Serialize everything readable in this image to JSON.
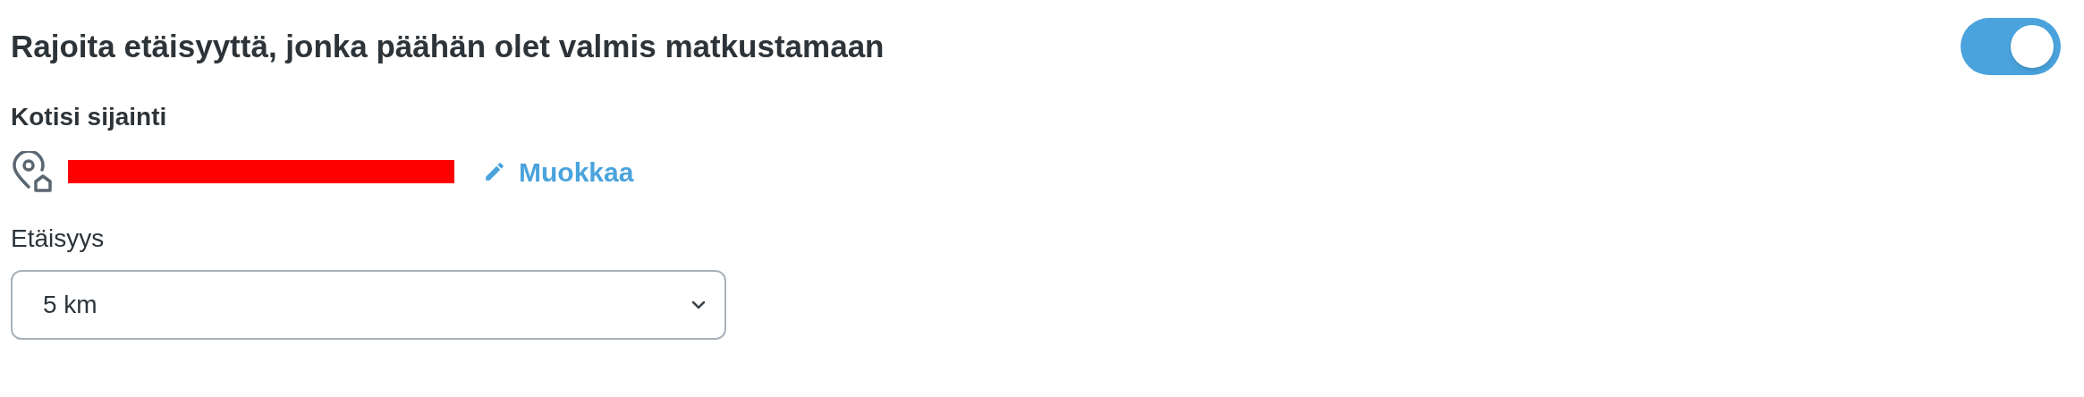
{
  "header": {
    "title": "Rajoita etäisyyttä, jonka päähän olet valmis matkustamaan",
    "toggle": {
      "on": true
    }
  },
  "location": {
    "label": "Kotisi sijainti",
    "edit_link": "Muokkaa"
  },
  "distance": {
    "label": "Etäisyys",
    "value": "5 km"
  }
}
